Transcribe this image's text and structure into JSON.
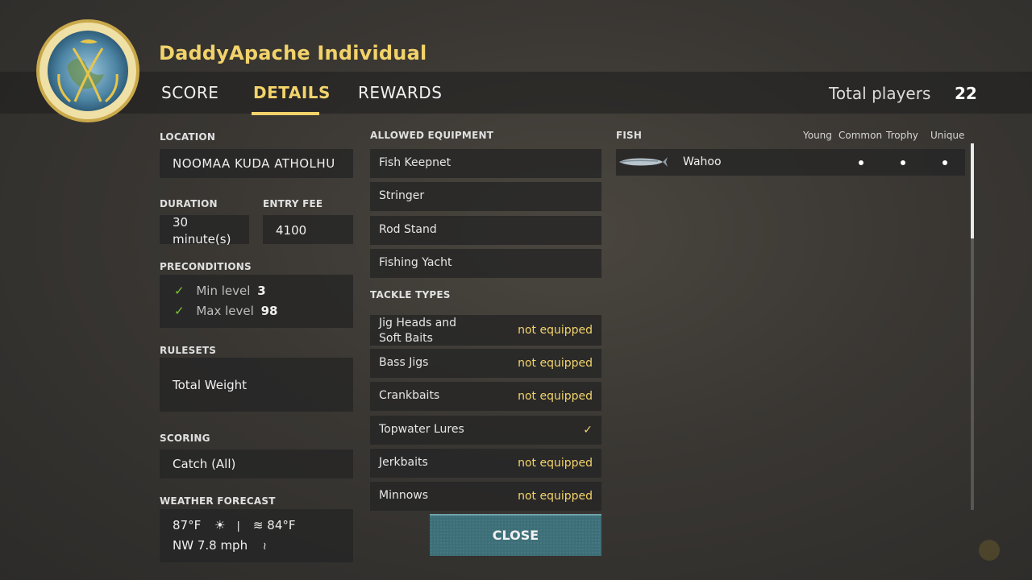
{
  "header": {
    "title": "DaddyApache Individual",
    "tabs": [
      {
        "label": "SCORE",
        "active": false
      },
      {
        "label": "DETAILS",
        "active": true
      },
      {
        "label": "REWARDS",
        "active": false
      }
    ],
    "total_players_label": "Total players",
    "total_players_value": "22",
    "emblem_icon": "tournament-emblem-icon"
  },
  "details": {
    "location_label": "LOCATION",
    "location_value": "NOOMAA KUDA ATHOLHU",
    "duration_label": "DURATION",
    "duration_value_line1": "30",
    "duration_value_line2": "minute(s)",
    "entry_fee_label": "ENTRY FEE",
    "entry_fee_value": "4100",
    "preconditions_label": "PRECONDITIONS",
    "preconditions": [
      {
        "label": "Min level",
        "value": "3"
      },
      {
        "label": "Max level",
        "value": "98"
      }
    ],
    "rulesets_label": "RULESETS",
    "rulesets_value": "Total Weight",
    "scoring_label": "SCORING",
    "scoring_value": "Catch (All)",
    "weather_label": "WEATHER FORECAST",
    "weather": {
      "air_temp": "87°F",
      "sun_icon": "☀",
      "thermo_icon": "🌡",
      "water_icon": "≋",
      "water_temp": "84°F",
      "wind": "NW 7.8 mph",
      "wind_icon": "wind-icon"
    }
  },
  "equipment": {
    "allowed_label": "ALLOWED EQUIPMENT",
    "allowed": [
      "Fish Keepnet",
      "Stringer",
      "Rod Stand",
      "Fishing Yacht"
    ],
    "tackle_label": "TACKLE TYPES",
    "tackle": [
      {
        "name_line1": "Jig Heads and",
        "name_line2": "Soft Baits",
        "status": "not equipped"
      },
      {
        "name_line1": "Bass Jigs",
        "name_line2": "",
        "status": "not equipped"
      },
      {
        "name_line1": "Crankbaits",
        "name_line2": "",
        "status": "not equipped"
      },
      {
        "name_line1": "Topwater Lures",
        "name_line2": "",
        "status": "✓"
      },
      {
        "name_line1": "Jerkbaits",
        "name_line2": "",
        "status": "not equipped"
      },
      {
        "name_line1": "Minnows",
        "name_line2": "",
        "status": "not equipped"
      }
    ]
  },
  "fish": {
    "label": "FISH",
    "columns": [
      "Young",
      "Common",
      "Trophy",
      "Unique"
    ],
    "rows": [
      {
        "name": "Wahoo",
        "icon": "wahoo-fish-icon",
        "young": false,
        "common": true,
        "trophy": true,
        "unique": true
      }
    ]
  },
  "close_label": "CLOSE",
  "colors": {
    "accent": "#f2d36b",
    "check": "#7bc23a",
    "button": "#3d6f78"
  }
}
